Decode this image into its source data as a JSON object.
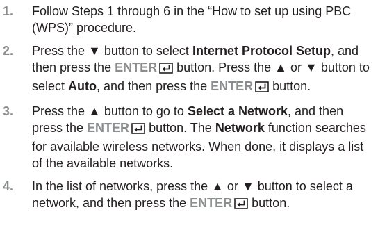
{
  "steps": [
    {
      "number": "1.",
      "segments": [
        {
          "type": "text",
          "text": "Follow Steps 1 through 6 in the “How to set up using PBC (WPS)” procedure."
        }
      ]
    },
    {
      "number": "2.",
      "segments": [
        {
          "type": "text",
          "text": "Press the ▼ button to select "
        },
        {
          "type": "bold",
          "text": "Internet Protocol Setup"
        },
        {
          "type": "text",
          "text": ", and then press the "
        },
        {
          "type": "key",
          "text": "ENTER",
          "icon": "enter-key-icon"
        },
        {
          "type": "text",
          "text": " button. Press the ▲ or ▼ button to select "
        },
        {
          "type": "bold",
          "text": "Auto"
        },
        {
          "type": "text",
          "text": ", and then press the "
        },
        {
          "type": "key",
          "text": "ENTER",
          "icon": "enter-key-icon"
        },
        {
          "type": "text",
          "text": " button."
        }
      ]
    },
    {
      "number": "3.",
      "segments": [
        {
          "type": "text",
          "text": "Press the ▲ button to go to "
        },
        {
          "type": "bold",
          "text": "Select a Network"
        },
        {
          "type": "text",
          "text": ", and then press the "
        },
        {
          "type": "key",
          "text": "ENTER",
          "icon": "enter-key-icon"
        },
        {
          "type": "text",
          "text": " button. The "
        },
        {
          "type": "bold",
          "text": "Network"
        },
        {
          "type": "text",
          "text": " function searches for available wireless networks. When done, it displays a list of the available networks."
        }
      ]
    },
    {
      "number": "4.",
      "segments": [
        {
          "type": "text",
          "text": "In the list of networks, press the ▲ or ▼ button to select a network, and then press the "
        },
        {
          "type": "key",
          "text": "ENTER",
          "icon": "enter-key-icon"
        },
        {
          "type": "text",
          "text": " button."
        }
      ]
    }
  ],
  "colors": {
    "body_text": "#231f20",
    "step_number": "#8a8c8e",
    "key_text": "#8a8c8e"
  }
}
